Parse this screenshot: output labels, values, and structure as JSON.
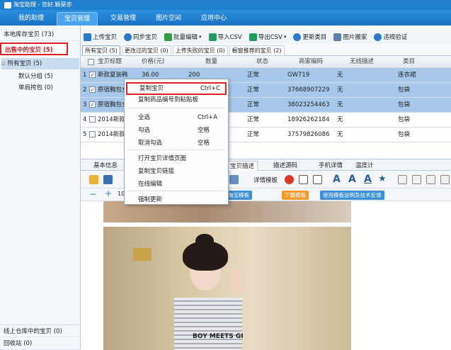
{
  "window": {
    "title": "淘宝助理 - 您好,颖葵亦"
  },
  "topnav": {
    "tabs": [
      "我的助理",
      "宝贝管理",
      "交易管理",
      "图片空间",
      "应用中心"
    ]
  },
  "sidebar": {
    "local": "本地库存宝贝 (73)",
    "onsale": "出售中的宝贝 (5)",
    "all": "所有宝贝 (5)",
    "default": "默认分组 (5)",
    "bags": "单肩挎包 (0)",
    "warehouse": "线上仓库中的宝贝 (0)",
    "recycle": "回收站 (0)"
  },
  "toolbar": [
    "上传宝贝",
    "同步宝贝",
    "批量编辑",
    "导入CSV",
    "导出CSV",
    "更新类目",
    "图片搬家",
    "违规验证"
  ],
  "subtabs": [
    "所有宝贝 (5)",
    "更改过的宝贝 (0)",
    "上传失败的宝贝 (0)",
    "橱窗推荐的宝贝 (2)"
  ],
  "grid": {
    "headers": [
      "宝贝标题",
      "价格(元)",
      "数量",
      "状态",
      "商家编码",
      "无线描述",
      "类目"
    ],
    "rows": [
      {
        "num": "1",
        "title": "新款夏装韩",
        "price": "36.00",
        "qty": "200",
        "status": "正常",
        "code": "GW719",
        "mobile": "无",
        "cat": "连衣裙",
        "checked": true,
        "selected": true
      },
      {
        "num": "2",
        "title": "原宿胸包女",
        "price": "",
        "qty": "",
        "status": "正常",
        "code": "37668907229",
        "mobile": "无",
        "cat": "包袋",
        "checked": true,
        "selected": true
      },
      {
        "num": "3",
        "title": "原宿胸包女",
        "price": "",
        "qty": "",
        "status": "正常",
        "code": "38023254463",
        "mobile": "无",
        "cat": "包袋",
        "checked": true,
        "selected": true
      },
      {
        "num": "4",
        "title": "2014新款",
        "price": "",
        "qty": "",
        "status": "正常",
        "code": "18926262184",
        "mobile": "无",
        "cat": "包袋",
        "checked": false,
        "selected": false
      },
      {
        "num": "5",
        "title": "2014新款",
        "price": "",
        "qty": "",
        "status": "正常",
        "code": "37579826086",
        "mobile": "无",
        "cat": "包袋",
        "checked": false,
        "selected": false
      }
    ]
  },
  "detail": {
    "tabs": [
      "基本信息",
      "宝贝描述",
      "描述源码",
      "手机详情",
      "温度计"
    ],
    "tmpl_btn": "淘宝模板",
    "detail_tmpl": "详情模板",
    "download_btn": "下载模板",
    "help_btn": "使用模板说明及技术反馈"
  },
  "image": {
    "shirt_text": "BOY MEETS GI"
  },
  "menu": {
    "items": [
      {
        "label": "复制宝贝",
        "shortcut": "Ctrl+C"
      },
      {
        "label": "复制商品编号到粘贴板",
        "shortcut": ""
      },
      {
        "label": "全选",
        "shortcut": "Ctrl+A"
      },
      {
        "label": "勾选",
        "shortcut": "空格"
      },
      {
        "label": "取消勾选",
        "shortcut": "空格"
      },
      {
        "label": "打开宝贝详情页面",
        "shortcut": ""
      },
      {
        "label": "复制宝贝链接",
        "shortcut": ""
      },
      {
        "label": "在线编辑",
        "shortcut": ""
      },
      {
        "label": "强制更新",
        "shortcut": ""
      }
    ]
  },
  "colors": {
    "accent": "#1f7fd0",
    "highlight_red": "#e02020",
    "selection": "#a7c8ea",
    "orange": "#f39a2b"
  }
}
